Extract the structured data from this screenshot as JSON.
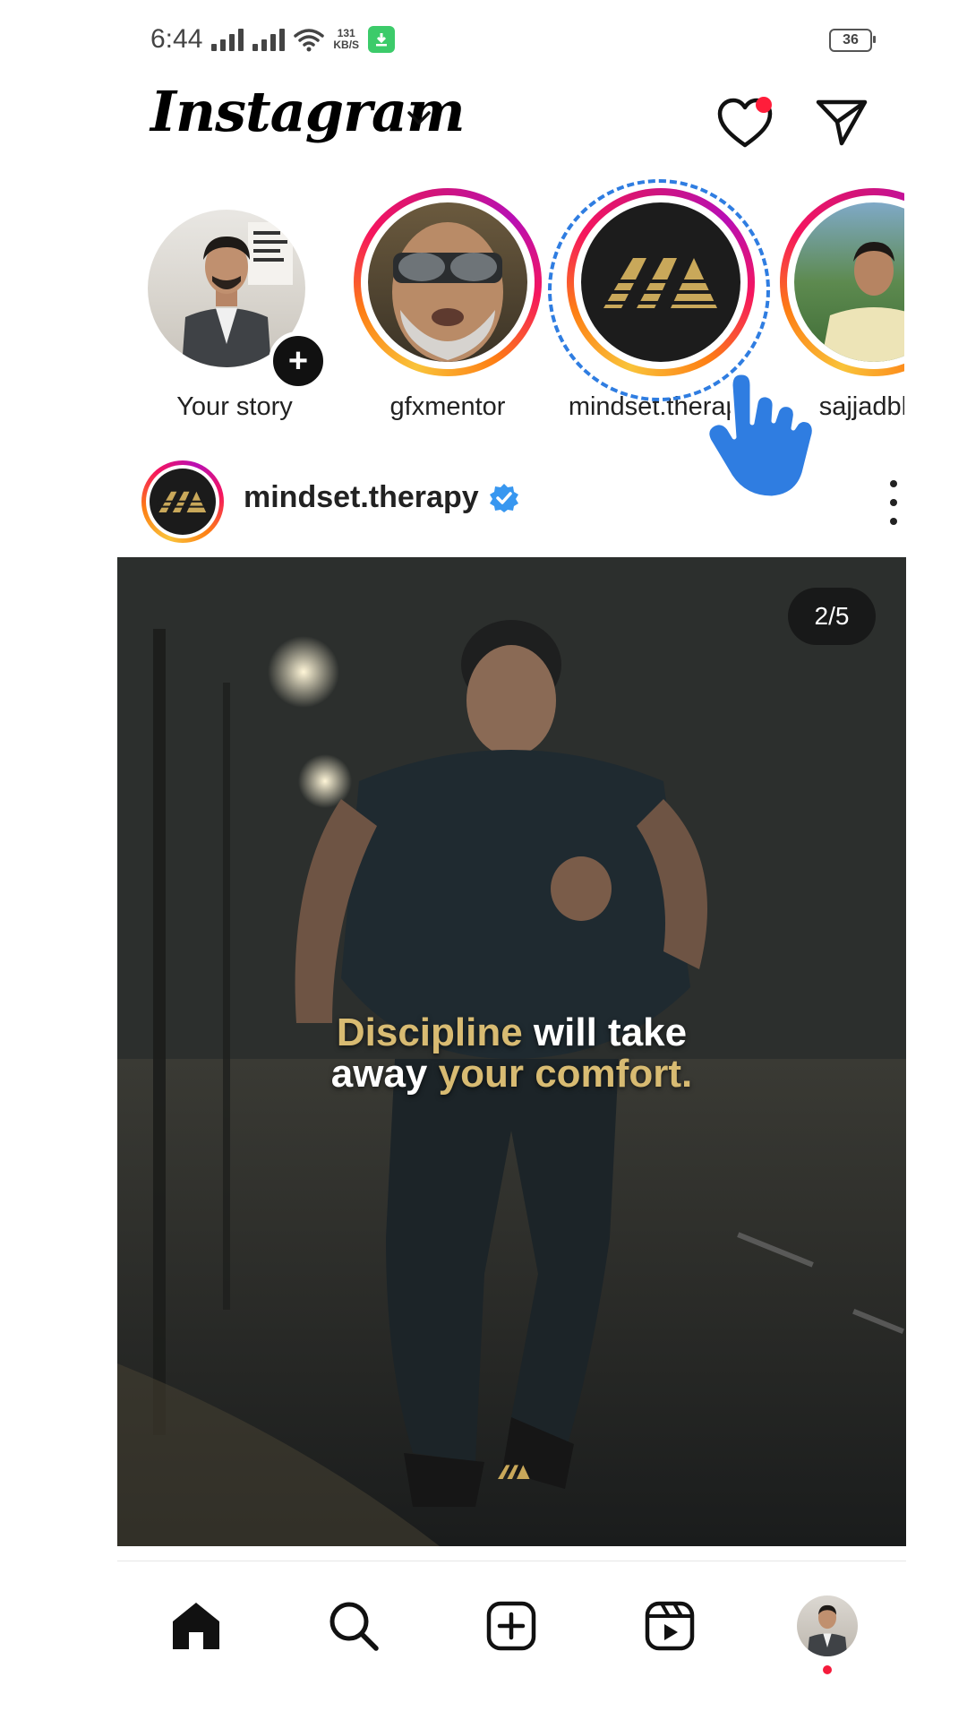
{
  "status_bar": {
    "time": "6:44",
    "net_speed_value": "131",
    "net_speed_unit": "KB/S",
    "battery": "36"
  },
  "header": {
    "app_name": "Instagram",
    "notification_dot_color": "#ff1d3a"
  },
  "stories": [
    {
      "label": "Your story"
    },
    {
      "label": "gfxmentor"
    },
    {
      "label": "mindset.therapy"
    },
    {
      "label": "sajjadbhti"
    }
  ],
  "post": {
    "username": "mindset.therapy",
    "verified": true,
    "counter": "2/5",
    "caption_line1_gold": "Discipline",
    "caption_line1_white": " will take",
    "caption_line2_white": "away ",
    "caption_line2_gold": "your comfort."
  },
  "bottom_nav": [
    "home-icon",
    "search-icon",
    "create-icon",
    "reels-icon",
    "profile-avatar"
  ],
  "colors": {
    "accent_blue": "#2f7de1",
    "gold_text": "#d8bb72",
    "verified_blue": "#3897f0"
  }
}
